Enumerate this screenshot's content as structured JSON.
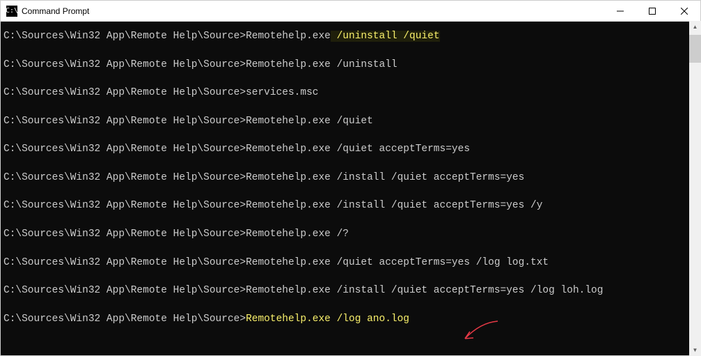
{
  "window": {
    "title": "Command Prompt",
    "icon_label": "C:\\"
  },
  "prompt": "C:\\Sources\\Win32 App\\Remote Help\\Source>",
  "lines": [
    {
      "command": "Remotehelp.exe",
      "args": " /uninstall /quiet",
      "style": "highlight"
    },
    {
      "command": "Remotehelp.exe /uninstall",
      "args": "",
      "style": "plain"
    },
    {
      "command": "services.msc",
      "args": "",
      "style": "plain"
    },
    {
      "command": "Remotehelp.exe /quiet",
      "args": "",
      "style": "plain"
    },
    {
      "command": "Remotehelp.exe /quiet acceptTerms=yes",
      "args": "",
      "style": "plain"
    },
    {
      "command": "Remotehelp.exe /install /quiet acceptTerms=yes",
      "args": "",
      "style": "plain"
    },
    {
      "command": "Remotehelp.exe /install /quiet acceptTerms=yes /y",
      "args": "",
      "style": "plain"
    },
    {
      "command": "Remotehelp.exe /?",
      "args": "",
      "style": "plain"
    },
    {
      "command": "Remotehelp.exe /quiet acceptTerms=yes /log log.txt",
      "args": "",
      "style": "plain"
    },
    {
      "command": "Remotehelp.exe /install /quiet acceptTerms=yes /log loh.log",
      "args": "",
      "style": "plain"
    },
    {
      "command": "Remotehelp.exe /log ano.log",
      "args": "",
      "style": "yellow"
    }
  ]
}
